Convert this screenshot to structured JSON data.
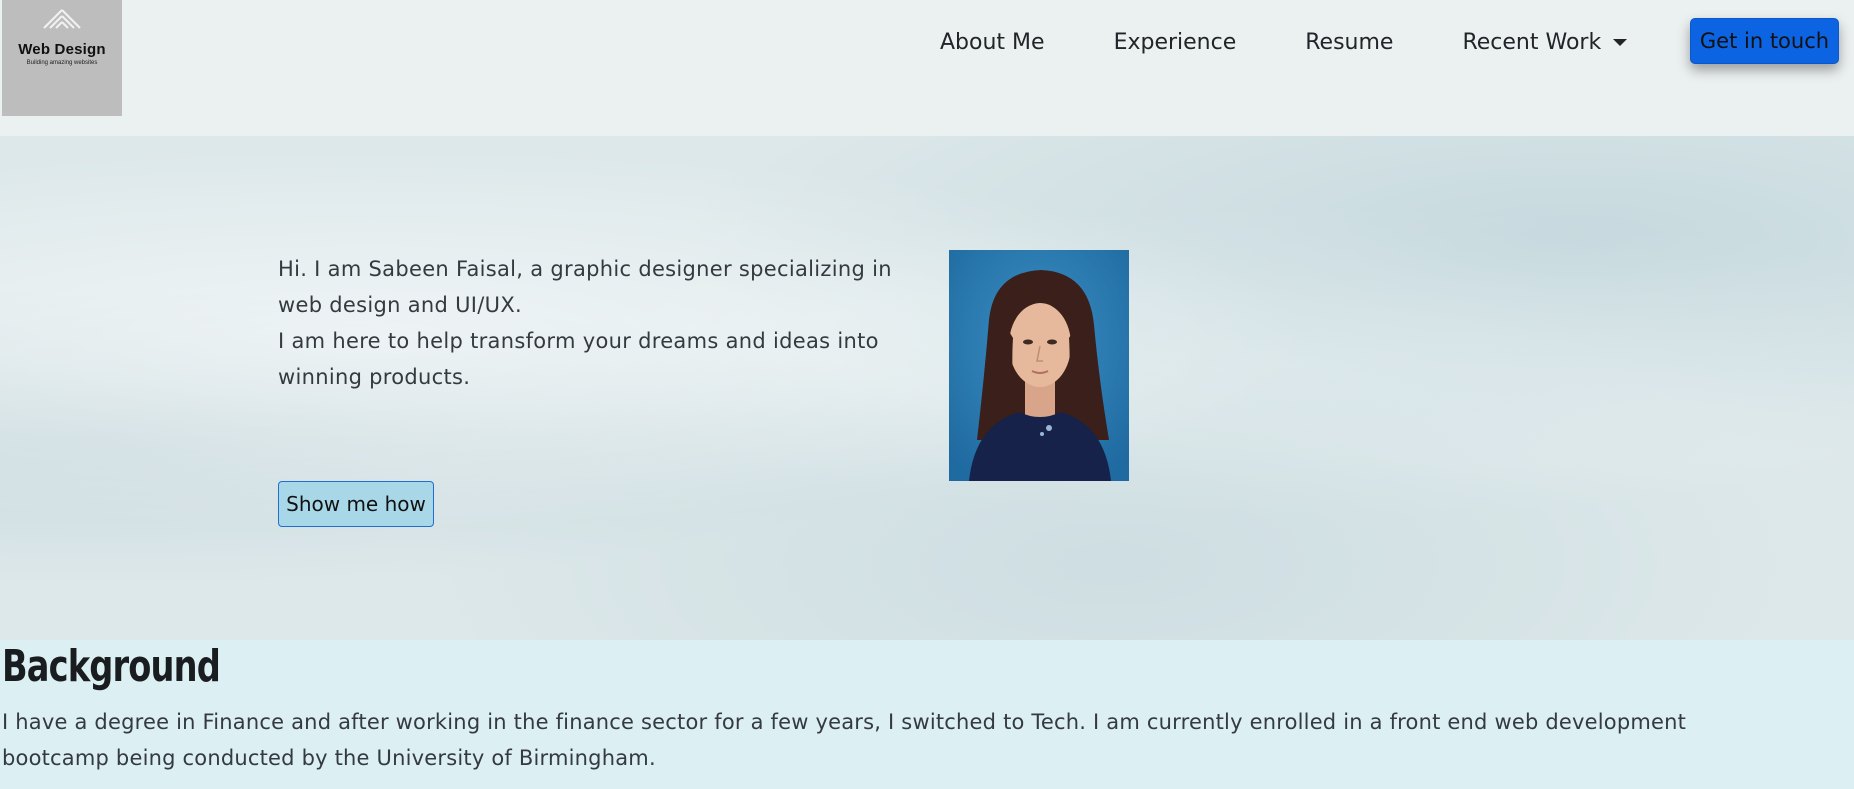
{
  "header": {
    "logo": {
      "icon": "diamond-logo-icon",
      "title": "Web Design",
      "subtitle": "Building amazing websites"
    },
    "nav": {
      "about": "About Me",
      "experience": "Experience",
      "resume": "Resume",
      "recent_work": "Recent Work"
    },
    "cta_label": "Get in touch"
  },
  "hero": {
    "intro_line1": "Hi. I am Sabeen Faisal, a graphic designer specializing in web design and UI/UX.",
    "intro_line2": "I am here to help transform your dreams and ideas into winning products.",
    "button_label": "Show me how",
    "portrait_icon": "portrait-photo"
  },
  "background": {
    "title": "Background",
    "text": "I have a degree in Finance and after working in the finance sector for a few years, I switched to Tech. I am currently enrolled in a front end web development bootcamp being conducted by the University of Birmingham."
  },
  "colors": {
    "accent": "#0d64e3",
    "hero_button": "#a8d8e8",
    "section_bg": "#dceff3"
  }
}
